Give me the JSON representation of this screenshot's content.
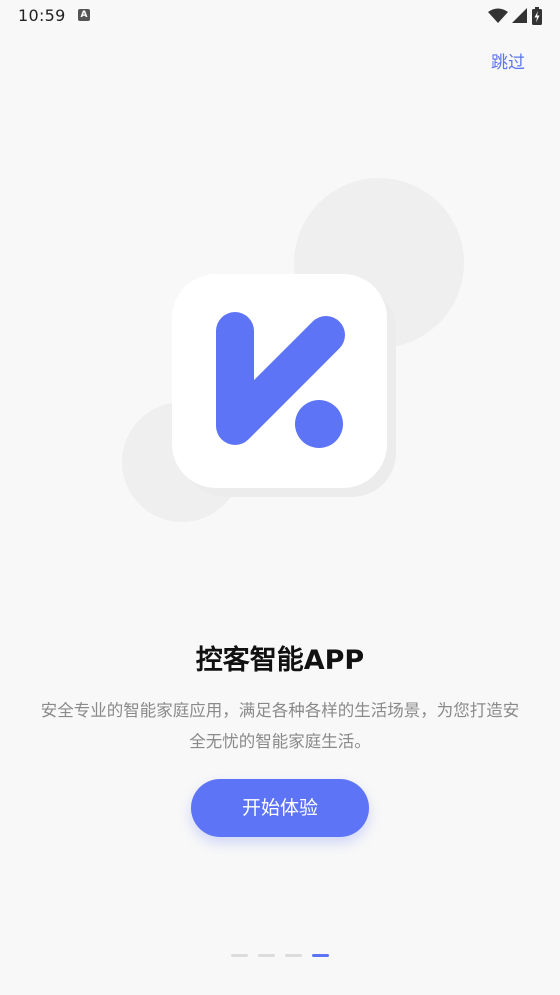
{
  "status_bar": {
    "time": "10:59",
    "notification_badge": "A",
    "icons": [
      "wifi-icon",
      "signal-icon",
      "battery-charging-icon"
    ]
  },
  "header": {
    "skip_label": "跳过"
  },
  "content": {
    "title": "控客智能APP",
    "description": "安全专业的智能家庭应用，满足各种各样的生活场景，为您打造安全无忧的智能家庭生活。",
    "start_label": "开始体验"
  },
  "pager": {
    "total": 4,
    "active_index": 3
  },
  "colors": {
    "accent": "#5d74f6",
    "skip_text": "#5b74f3",
    "background": "#f8f8f8",
    "description_text": "#8a8a8a",
    "deco_circle": "#efefef"
  },
  "logo": {
    "icon": "k-logo-icon"
  }
}
